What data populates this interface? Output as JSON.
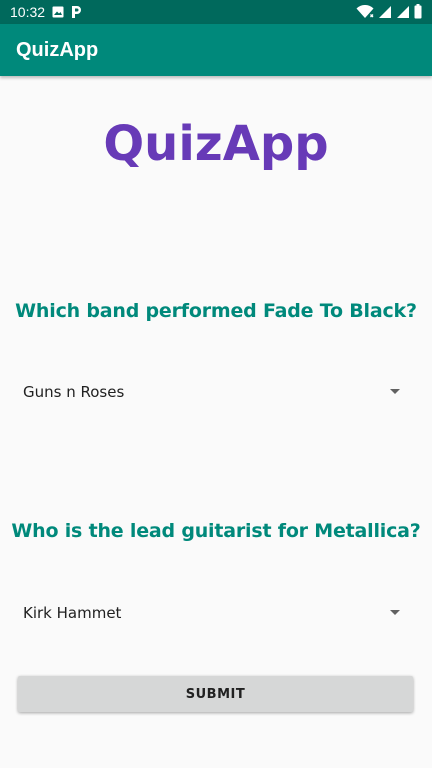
{
  "status_bar": {
    "time": "10:32",
    "left_icons": [
      "image-icon",
      "parking-icon"
    ],
    "right_icons": [
      "wifi-icon",
      "signal-icon",
      "signal-icon",
      "battery-icon"
    ]
  },
  "app_bar": {
    "title": "QuizApp"
  },
  "main": {
    "logo_text": "QuizApp",
    "questions": [
      {
        "text": "Which band performed Fade To Black?",
        "selected_answer": "Guns n Roses"
      },
      {
        "text": "Who is the lead guitarist for Metallica?",
        "selected_answer": "Kirk Hammet"
      }
    ],
    "submit_label": "SUBMIT"
  },
  "colors": {
    "status_bar": "#00695c",
    "app_bar": "#00897b",
    "logo": "#673ab7",
    "question_text": "#00897b",
    "button_bg": "#d6d7d7"
  }
}
